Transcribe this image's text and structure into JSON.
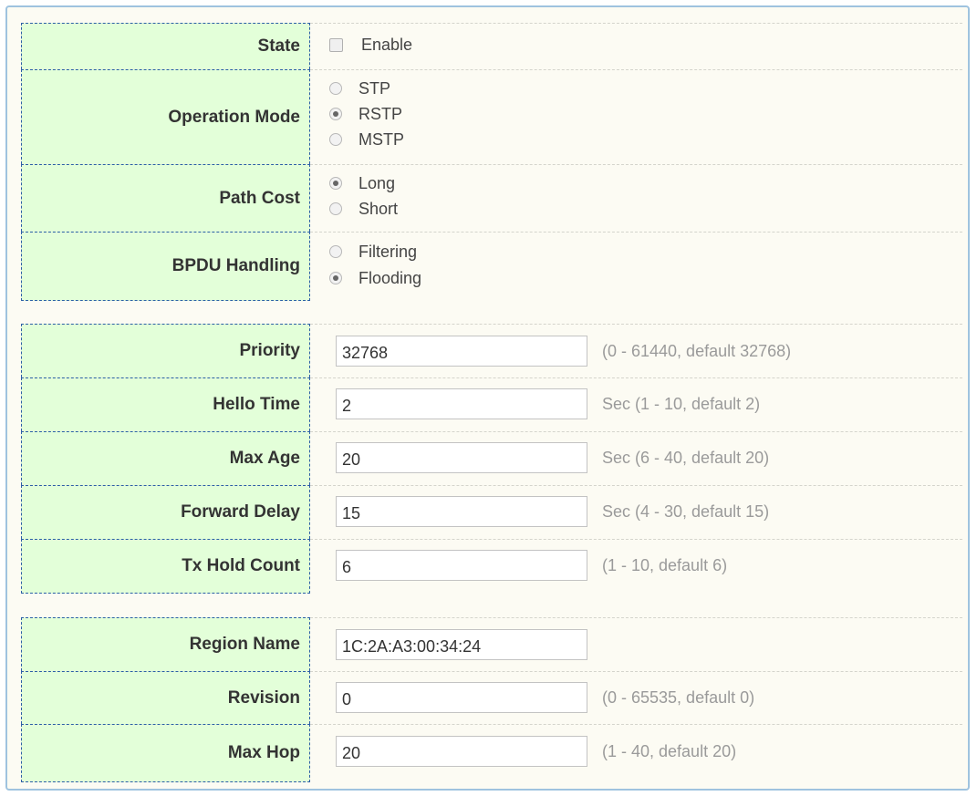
{
  "stp": {
    "state": {
      "label": "State",
      "checkbox_label": "Enable",
      "checked": false
    },
    "operation_mode": {
      "label": "Operation Mode",
      "options": [
        "STP",
        "RSTP",
        "MSTP"
      ],
      "selected": "RSTP"
    },
    "path_cost": {
      "label": "Path Cost",
      "options": [
        "Long",
        "Short"
      ],
      "selected": "Long"
    },
    "bpdu_handling": {
      "label": "BPDU Handling",
      "options": [
        "Filtering",
        "Flooding"
      ],
      "selected": "Flooding"
    },
    "priority": {
      "label": "Priority",
      "value": "32768",
      "hint": "(0 - 61440, default 32768)"
    },
    "hello_time": {
      "label": "Hello Time",
      "value": "2",
      "hint": "Sec (1 - 10, default 2)"
    },
    "max_age": {
      "label": "Max Age",
      "value": "20",
      "hint": "Sec (6 - 40, default 20)"
    },
    "forward_delay": {
      "label": "Forward Delay",
      "value": "15",
      "hint": "Sec (4 - 30, default 15)"
    },
    "tx_hold_count": {
      "label": "Tx Hold Count",
      "value": "6",
      "hint": "(1 - 10, default 6)"
    },
    "region_name": {
      "label": "Region Name",
      "value": "1C:2A:A3:00:34:24"
    },
    "revision": {
      "label": "Revision",
      "value": "0",
      "hint": "(0 - 65535, default 0)"
    },
    "max_hop": {
      "label": "Max Hop",
      "value": "20",
      "hint": "(1 - 40, default 20)"
    }
  }
}
